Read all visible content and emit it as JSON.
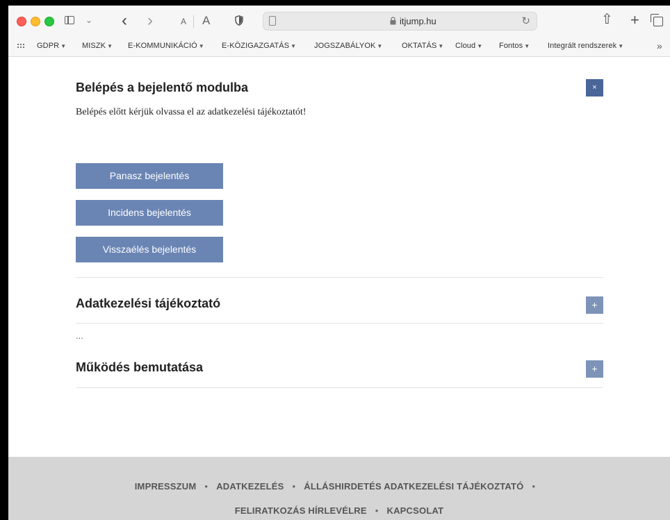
{
  "browser": {
    "url": "itjump.hu",
    "font_small_label": "A",
    "font_large_label": "A",
    "bookmarks": [
      {
        "label": "GDPR"
      },
      {
        "label": "MISZK"
      },
      {
        "label": "E-KOMMUNIKÁCIÓ"
      },
      {
        "label": "E-KÖZIGAZGATÁS"
      },
      {
        "label": "JOGSZABÁLYOK"
      },
      {
        "label": "OKTATÁS"
      },
      {
        "label": "Cloud"
      },
      {
        "label": "Fontos"
      },
      {
        "label": "Integrált rendszerek"
      }
    ],
    "more_label": "»"
  },
  "modal": {
    "title": "Belépés a bejelentő modulba",
    "close_label": "×",
    "intro": "Belépés előtt kérjük olvassa el az adatkezelési tájékoztatót!",
    "buttons": [
      {
        "label": "Panasz bejelentés"
      },
      {
        "label": "Incidens bejelentés"
      },
      {
        "label": "Visszaélés bejelentés"
      }
    ]
  },
  "sections": [
    {
      "title": "Adatkezelési tájékoztató",
      "toggle": "+"
    },
    {
      "title": "Működés bemutatása",
      "toggle": "+"
    }
  ],
  "ellipsis": "...",
  "footer": {
    "row1": [
      "IMPRESSZUM",
      "ADATKEZELÉS",
      "ÁLLÁSHIRDETÉS ADATKEZELÉSI TÁJÉKOZTATÓ"
    ],
    "row2": [
      "FELIRATKOZÁS HÍRLEVÉLRE",
      "KAPCSOLAT"
    ],
    "separator": "•"
  },
  "colors": {
    "button_primary": "#6a85b4",
    "close_button": "#4a6598",
    "toggle_button": "#7e93b8",
    "footer_bg": "#d5d5d5"
  }
}
